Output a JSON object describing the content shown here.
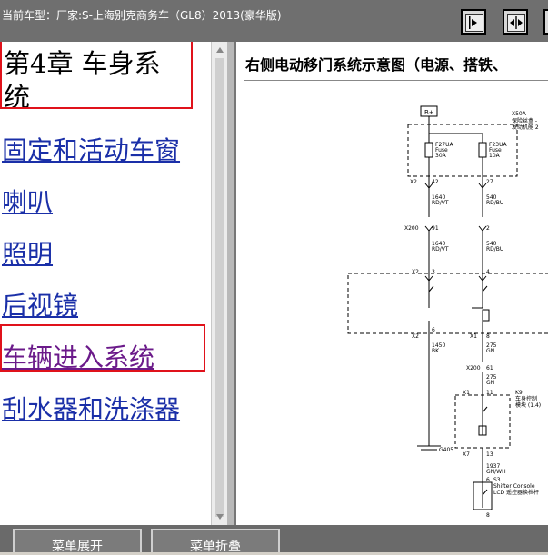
{
  "window": {
    "title": "当前车型：厂家:S-上海别克商务车（GL8）2013(豪华版)"
  },
  "toolbar": {
    "buttons": [
      {
        "name": "expand-right-icon"
      },
      {
        "name": "split-view-icon"
      },
      {
        "name": "expand-left-icon"
      }
    ]
  },
  "sidebar": {
    "chapter": "第4章  车身系统",
    "items": [
      {
        "label": "固定和活动车窗"
      },
      {
        "label": "喇叭"
      },
      {
        "label": "照明"
      },
      {
        "label": "后视镜"
      },
      {
        "label": "车辆进入系统"
      },
      {
        "label": "刮水器和洗涤器"
      }
    ]
  },
  "diagram": {
    "title": "右侧电动移门系统示意图（电源、搭铁、",
    "labels": {
      "bplus": "B+",
      "x50a": "X50A",
      "fuse_block": "保险丝盒 -",
      "fuse_block2": "发动机舱 2",
      "f27ua": "F27UA",
      "f27ua_type": "Fuse",
      "f27ua_amp": "30A",
      "f23ua": "F23UA",
      "f23ua_type": "Fuse",
      "f23ua_amp": "10A",
      "x2": "X2",
      "pin42": "42",
      "pin27": "27",
      "w1640a": "1640",
      "c1640a": "RD/VT",
      "w540a": "540",
      "c540a": "RD/BU",
      "x200": "X200",
      "pin91": "91",
      "pin2": "2",
      "w1640b": "1640",
      "c1640b": "RD/VT",
      "w540b": "540",
      "c540b": "RD/BU",
      "x2b": "X2",
      "pin3": "3",
      "pin4": "4",
      "x2c": "X2",
      "pin6": "6",
      "x1": "X1",
      "pin8": "8",
      "w1450": "1450",
      "c1450": "BK",
      "w275a": "275",
      "c275a": "GN",
      "x200b": "X200",
      "pin61": "61",
      "w275b": "275",
      "c275b": "GN",
      "x1b": "X1",
      "pin11": "11",
      "k9": "K9",
      "k9_name": "车身控制",
      "k9_name2": "模块 (1.4)",
      "x7": "X7",
      "pin13": "13",
      "g405": "G405",
      "w1937": "1937",
      "c1937": "GN/WH",
      "s3_pin": "6",
      "s3": "S3",
      "s3_name": "Shifter Console",
      "s3_name2": "LCD 遥控器换档杆",
      "s3_pin2": "8"
    }
  },
  "footer": {
    "expand_label": "菜单展开",
    "collapse_label": "菜单折叠"
  }
}
